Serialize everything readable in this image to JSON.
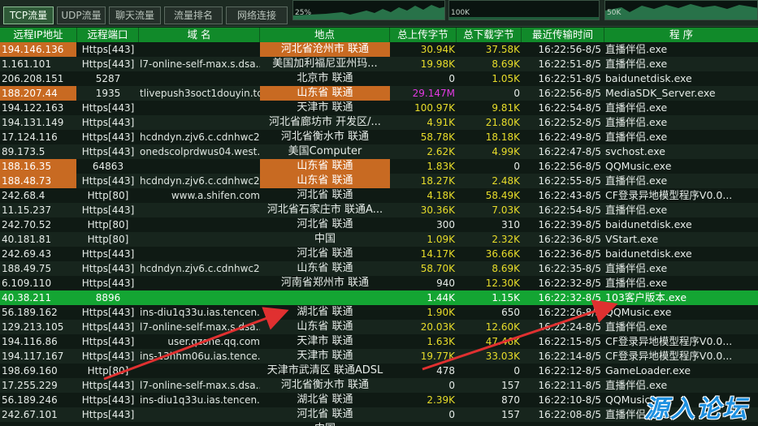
{
  "tabs": [
    {
      "label": "TCP流量",
      "active": true
    },
    {
      "label": "UDP流量",
      "active": false
    },
    {
      "label": "聊天流量",
      "active": false
    },
    {
      "label": "流量排名",
      "active": false
    },
    {
      "label": "网络连接",
      "active": false
    }
  ],
  "graphs": [
    {
      "label": "25%"
    },
    {
      "label": "100K"
    },
    {
      "label": "50K"
    }
  ],
  "columns": [
    "远程IP地址",
    "远程端口",
    "域 名",
    "地点",
    "总上传字节",
    "总下载字节",
    "最近传输时间",
    "程 序"
  ],
  "rows": [
    {
      "ip": "194.146.136",
      "port": "Https[443]",
      "domain": "",
      "location": "河北省沧州市 联通",
      "up": "30.94K",
      "down": "37.58K",
      "time": "16:22:56-8/5",
      "program": "直播伴侣.exe",
      "ip_orange": true,
      "loc_orange": true
    },
    {
      "ip": "1.161.101",
      "port": "Https[443]",
      "domain": "l7-online-self-max.s.dsa...",
      "location": "美国加利福尼亚州玛...",
      "up": "19.98K",
      "down": "8.69K",
      "time": "16:22:51-8/5",
      "program": "直播伴侣.exe"
    },
    {
      "ip": "206.208.151",
      "port": "5287",
      "domain": "",
      "location": "北京市 联通",
      "up": "0",
      "down": "1.05K",
      "time": "16:22:51-8/5",
      "program": "baidunetdisk.exe"
    },
    {
      "ip": "188.207.44",
      "port": "1935",
      "domain": "tlivepush3soct1douyin.tc...",
      "location": "山东省 联通",
      "up": "29.147M",
      "down": "0",
      "time": "16:22:56-8/5",
      "program": "MediaSDK_Server.exe",
      "ip_orange": true,
      "loc_orange": true
    },
    {
      "ip": "194.122.163",
      "port": "Https[443]",
      "domain": "",
      "location": "天津市 联通",
      "up": "100.97K",
      "down": "9.81K",
      "time": "16:22:54-8/5",
      "program": "直播伴侣.exe"
    },
    {
      "ip": "194.131.149",
      "port": "Https[443]",
      "domain": "",
      "location": "河北省廊坊市 开发区/...",
      "up": "4.91K",
      "down": "21.80K",
      "time": "16:22:52-8/5",
      "program": "直播伴侣.exe"
    },
    {
      "ip": "17.124.116",
      "port": "Https[443]",
      "domain": "hcdndyn.zjv6.c.cdnhwc2...",
      "location": "河北省衡水市 联通",
      "up": "58.78K",
      "down": "18.18K",
      "time": "16:22:49-8/5",
      "program": "直播伴侣.exe"
    },
    {
      "ip": "89.173.5",
      "port": "Https[443]",
      "domain": "onedscolprdwus04.west...",
      "location": "美国Computer",
      "up": "2.62K",
      "down": "4.99K",
      "time": "16:22:47-8/5",
      "program": "svchost.exe"
    },
    {
      "ip": "188.16.35",
      "port": "64863",
      "domain": "",
      "location": "山东省 联通",
      "up": "1.83K",
      "down": "0",
      "time": "16:22:56-8/5",
      "program": "QQMusic.exe",
      "ip_orange": true,
      "loc_orange": true
    },
    {
      "ip": "188.48.73",
      "port": "Https[443]",
      "domain": "hcdndyn.zjv6.c.cdnhwc2...",
      "location": "山东省 联通",
      "up": "18.27K",
      "down": "2.48K",
      "time": "16:22:55-8/5",
      "program": "直播伴侣.exe",
      "ip_orange": true,
      "loc_orange": true
    },
    {
      "ip": "242.68.4",
      "port": "Http[80]",
      "domain": "www.a.shifen.com",
      "location": "河北省 联通",
      "up": "4.18K",
      "down": "58.49K",
      "time": "16:22:43-8/5",
      "program": "CF登录异地模型程序V0.0...",
      "dom_right": true
    },
    {
      "ip": "11.15.237",
      "port": "Https[443]",
      "domain": "",
      "location": "河北省石家庄市 联通A...",
      "up": "30.36K",
      "down": "7.03K",
      "time": "16:22:54-8/5",
      "program": "直播伴侣.exe"
    },
    {
      "ip": "242.70.52",
      "port": "Http[80]",
      "domain": "",
      "location": "河北省 联通",
      "up": "300",
      "down": "310",
      "time": "16:22:39-8/5",
      "program": "baidunetdisk.exe"
    },
    {
      "ip": "40.181.81",
      "port": "Http[80]",
      "domain": "",
      "location": "中国",
      "up": "1.09K",
      "down": "2.32K",
      "time": "16:22:36-8/5",
      "program": "VStart.exe"
    },
    {
      "ip": "242.69.43",
      "port": "Https[443]",
      "domain": "",
      "location": "河北省 联通",
      "up": "14.17K",
      "down": "36.66K",
      "time": "16:22:36-8/5",
      "program": "baidunetdisk.exe"
    },
    {
      "ip": "188.49.75",
      "port": "Https[443]",
      "domain": "hcdndyn.zjv6.c.cdnhwc2...",
      "location": "山东省 联通",
      "up": "58.70K",
      "down": "8.69K",
      "time": "16:22:35-8/5",
      "program": "直播伴侣.exe"
    },
    {
      "ip": "6.109.110",
      "port": "Https[443]",
      "domain": "",
      "location": "河南省郑州市 联通",
      "up": "940",
      "down": "12.30K",
      "time": "16:22:32-8/5",
      "program": "直播伴侣.exe"
    },
    {
      "ip": "40.38.211",
      "port": "8896",
      "domain": "",
      "location": "",
      "up": "1.44K",
      "down": "1.15K",
      "time": "16:22:32-8/5",
      "program": "103客户版本.exe",
      "highlight": true
    },
    {
      "ip": "56.189.162",
      "port": "Https[443]",
      "domain": "ins-diu1q33u.ias.tencen...",
      "location": "湖北省 联通",
      "up": "1.90K",
      "down": "650",
      "time": "16:22:26-8/5",
      "program": "QQMusic.exe"
    },
    {
      "ip": "129.213.105",
      "port": "Https[443]",
      "domain": "l7-online-self-max.s.dsa...",
      "location": "山东省 联通",
      "up": "20.03K",
      "down": "12.60K",
      "time": "16:22:24-8/5",
      "program": "直播伴侣.exe"
    },
    {
      "ip": "194.116.86",
      "port": "Https[443]",
      "domain": "user.qzone.qq.com",
      "location": "天津市 联通",
      "up": "1.63K",
      "down": "47.46K",
      "time": "16:22:15-8/5",
      "program": "CF登录异地模型程序V0.0...",
      "dom_right": true
    },
    {
      "ip": "194.117.167",
      "port": "Https[443]",
      "domain": "ins-13hhm06u.ias.tence...",
      "location": "天津市 联通",
      "up": "19.77K",
      "down": "33.03K",
      "time": "16:22:14-8/5",
      "program": "CF登录异地模型程序V0.0..."
    },
    {
      "ip": "198.69.160",
      "port": "Http[80]",
      "domain": "",
      "location": "天津市武清区 联通ADSL",
      "up": "478",
      "down": "0",
      "time": "16:22:12-8/5",
      "program": "GameLoader.exe"
    },
    {
      "ip": "17.255.229",
      "port": "Https[443]",
      "domain": "l7-online-self-max.s.dsa...",
      "location": "河北省衡水市 联通",
      "up": "0",
      "down": "157",
      "time": "16:22:11-8/5",
      "program": "直播伴侣.exe"
    },
    {
      "ip": "56.189.246",
      "port": "Https[443]",
      "domain": "ins-diu1q33u.ias.tencen...",
      "location": "湖北省 联通",
      "up": "2.39K",
      "down": "870",
      "time": "16:22:10-8/5",
      "program": "QQMusic.exe"
    },
    {
      "ip": "242.67.101",
      "port": "Https[443]",
      "domain": "",
      "location": "河北省 联通",
      "up": "0",
      "down": "157",
      "time": "16:22:08-8/5",
      "program": "直播伴侣.exe"
    },
    {
      "ip": "",
      "port": "",
      "domain": "",
      "location": "中国",
      "up": "",
      "down": "",
      "time": "",
      "program": ""
    }
  ],
  "watermark": "源入论坛",
  "colors": {
    "header_green": "#118a2a",
    "highlight_green": "#14a533",
    "orange": "#c86a22",
    "value_yellow": "#e8dd2a",
    "value_pink": "#e23ae2",
    "arrow_red": "#e03030"
  }
}
